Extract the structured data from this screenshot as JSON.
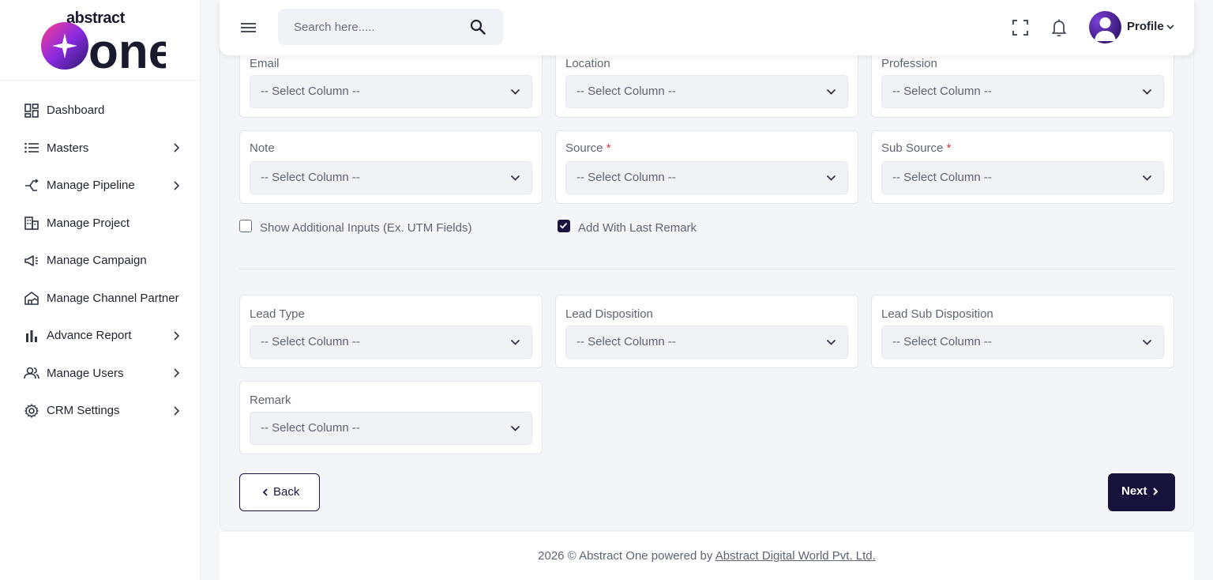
{
  "brand": {
    "top": "abstract",
    "main": "one"
  },
  "sidebar": {
    "items": [
      {
        "label": "Dashboard",
        "icon": "dashboard-icon",
        "has_children": false
      },
      {
        "label": "Masters",
        "icon": "list-icon",
        "has_children": true
      },
      {
        "label": "Manage Pipeline",
        "icon": "pipeline-icon",
        "has_children": true
      },
      {
        "label": "Manage Project",
        "icon": "building-icon",
        "has_children": false
      },
      {
        "label": "Manage Campaign",
        "icon": "megaphone-icon",
        "has_children": false
      },
      {
        "label": "Manage Channel Partner",
        "icon": "partner-icon",
        "has_children": false
      },
      {
        "label": "Advance Report",
        "icon": "bar-chart-icon",
        "has_children": true
      },
      {
        "label": "Manage Users",
        "icon": "users-icon",
        "has_children": true
      },
      {
        "label": "CRM Settings",
        "icon": "gear-icon",
        "has_children": true
      }
    ]
  },
  "header": {
    "search_placeholder": "Search here.....",
    "profile_label": "Profile"
  },
  "form": {
    "select_placeholder": "-- Select Column --",
    "fields": {
      "email": {
        "label": "Email",
        "value": "-- Select Column --"
      },
      "location": {
        "label": "Location",
        "value": "-- Select Column --"
      },
      "profession": {
        "label": "Profession",
        "value": "-- Select Column --"
      },
      "note": {
        "label": "Note",
        "value": "-- Select Column --"
      },
      "source": {
        "label": "Source",
        "required_mark": "*",
        "value": "-- Select Column --"
      },
      "sub_source": {
        "label": "Sub Source",
        "required_mark": "*",
        "value": "-- Select Column --"
      },
      "lead_type": {
        "label": "Lead Type",
        "value": "-- Select Column --"
      },
      "lead_disposition": {
        "label": "Lead Disposition",
        "value": "-- Select Column --"
      },
      "lead_sub_disposition": {
        "label": "Lead Sub Disposition",
        "value": "-- Select Column --"
      },
      "remark": {
        "label": "Remark",
        "value": "-- Select Column --"
      }
    },
    "checkboxes": {
      "show_additional": {
        "label": "Show Additional Inputs (Ex. UTM Fields)",
        "checked": false
      },
      "add_last_remark": {
        "label": "Add With Last Remark",
        "checked": true
      }
    },
    "buttons": {
      "back": "Back",
      "next": "Next"
    }
  },
  "footer": {
    "text": "2026 © Abstract One powered by",
    "link": "Abstract Digital World Pvt. Ltd."
  },
  "colors": {
    "primary": "#16123b",
    "required": "#d6334b",
    "brand_purple": "#7a3fd6"
  }
}
